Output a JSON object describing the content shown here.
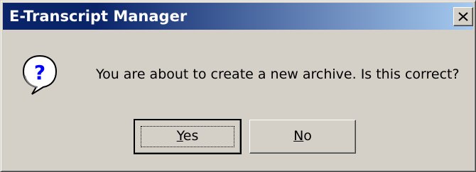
{
  "window": {
    "title": "E-Transcript Manager",
    "close_icon": "close-icon"
  },
  "message": {
    "icon": "question-icon",
    "text": "You are about to create a new archive. Is this correct?"
  },
  "buttons": {
    "yes": {
      "accel": "Y",
      "rest": "es",
      "default": true
    },
    "no": {
      "accel": "N",
      "rest": "o"
    }
  },
  "colors": {
    "title_bar_start": "#0a246a",
    "title_bar_end": "#a6caf0",
    "face": "#d4d0c8",
    "icon_fill": "#ffffff",
    "icon_glyph": "#0000ff"
  }
}
